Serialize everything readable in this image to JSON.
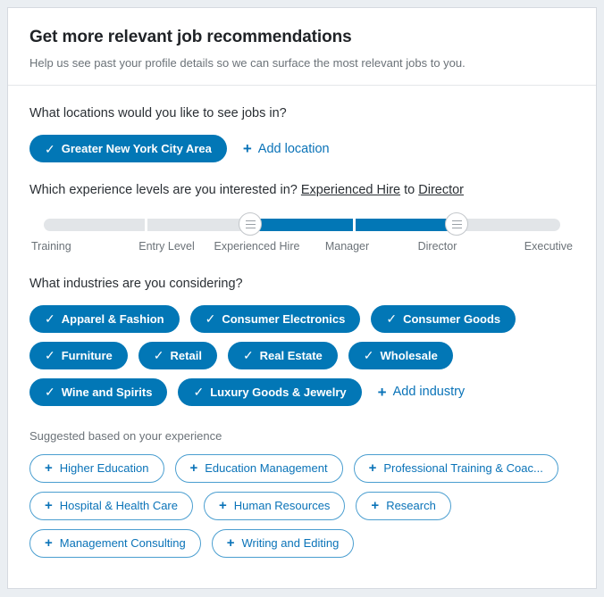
{
  "header": {
    "title": "Get more relevant job recommendations",
    "subtitle": "Help us see past your profile details so we can surface the most relevant jobs to you."
  },
  "locations": {
    "question": "What locations would you like to see jobs in?",
    "selected": [
      {
        "label": "Greater New York City Area",
        "glyph": "✓"
      }
    ],
    "add_label": "Add location",
    "add_glyph": "+"
  },
  "experience": {
    "question_prefix": "Which experience levels are you interested in?",
    "range_from": "Experienced Hire",
    "range_joiner": "to",
    "range_to": "Director",
    "levels": [
      "Training",
      "Entry Level",
      "Experienced Hire",
      "Manager",
      "Director",
      "Executive"
    ],
    "segments": [
      {
        "active": false
      },
      {
        "active": false
      },
      {
        "active": true
      },
      {
        "active": true
      },
      {
        "active": false
      }
    ],
    "handle_low_index": 2,
    "handle_high_index": 4
  },
  "industries": {
    "question": "What industries are you considering?",
    "selected": [
      {
        "label": "Apparel & Fashion",
        "glyph": "✓"
      },
      {
        "label": "Consumer Electronics",
        "glyph": "✓"
      },
      {
        "label": "Consumer Goods",
        "glyph": "✓"
      },
      {
        "label": "Furniture",
        "glyph": "✓"
      },
      {
        "label": "Retail",
        "glyph": "✓"
      },
      {
        "label": "Real Estate",
        "glyph": "✓"
      },
      {
        "label": "Wholesale",
        "glyph": "✓"
      },
      {
        "label": "Wine and Spirits",
        "glyph": "✓"
      },
      {
        "label": "Luxury Goods & Jewelry",
        "glyph": "✓"
      }
    ],
    "add_label": "Add industry",
    "add_glyph": "+",
    "suggested_label": "Suggested based on your experience",
    "suggested": [
      {
        "label": "Higher Education",
        "glyph": "+"
      },
      {
        "label": "Education Management",
        "glyph": "+"
      },
      {
        "label": "Professional Training & Coac...",
        "glyph": "+"
      },
      {
        "label": "Hospital & Health Care",
        "glyph": "+"
      },
      {
        "label": "Human Resources",
        "glyph": "+"
      },
      {
        "label": "Research",
        "glyph": "+"
      },
      {
        "label": "Management Consulting",
        "glyph": "+"
      },
      {
        "label": "Writing and Editing",
        "glyph": "+"
      }
    ]
  },
  "colors": {
    "brand_blue": "#0277b6",
    "link_blue": "#0a73b8",
    "track_gray": "#e2e5e8",
    "page_bg": "#eaeef2"
  }
}
